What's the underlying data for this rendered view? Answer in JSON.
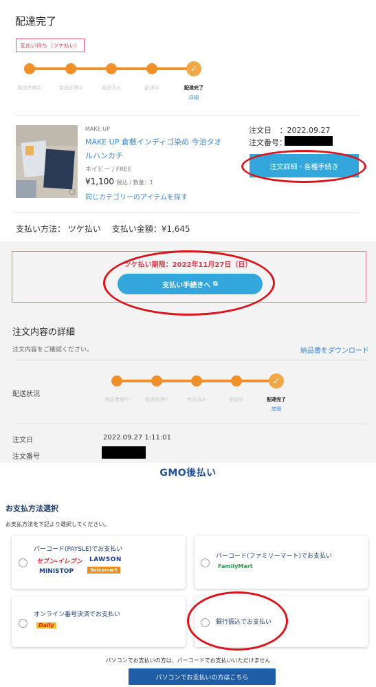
{
  "status": {
    "title": "配達完了",
    "wait_badge": "支払い待ち（ツケ払い）",
    "steps": [
      "発送準備中",
      "発送処理中",
      "発送済み",
      "配送中",
      "配達完了"
    ],
    "detail_link": "詳細"
  },
  "product": {
    "category": "MAKE UP",
    "name": "MAKE UP 倉敷インディゴ染め 今治タオルハンカチ",
    "variant": "ネイビー / FREE",
    "price": "¥1,100",
    "tax_qty": "税込 / 数量：1",
    "same_category_link": "同じカテゴリーのアイテムを探す"
  },
  "order": {
    "date_label": "注文日",
    "date_value": "：2022.09.27",
    "number_label": "注文番号",
    "number_colon": "：",
    "detail_button": "注文詳細・各種手続き"
  },
  "payment_summary": {
    "method_label": "支払い方法：",
    "method_value": "ツケ払い",
    "amount_label": "支払い金額：",
    "amount_value": "¥1,645"
  },
  "deadline": {
    "text": "ツケ払い期限：2022年11月27日（日）",
    "pay_button": "支払い手続きへ"
  },
  "details": {
    "heading": "注文内容の詳細",
    "sub": "注文内容をご確認ください。",
    "invoice_link": "納品書をダウンロード",
    "shipping_label": "配送状況",
    "order_date_label": "注文日",
    "order_date_value": "2022.09.27 1:11:01",
    "order_number_label": "注文番号"
  },
  "gmo": {
    "logo_gmo": "GMO",
    "logo_rest": "後払い",
    "heading": "お支払方法選択",
    "sub": "お支払方法を下記より選択してください。",
    "options": [
      {
        "title": "バーコード(PAYSLE)でお支払い"
      },
      {
        "title": "バーコード(ファミリーマート)でお支払い"
      },
      {
        "title": "オンライン番号決済でお支払い"
      },
      {
        "title": "銀行振込でお支払い"
      }
    ],
    "store_logos": {
      "seven": "セブン-イレブン",
      "lawson": "LAWSON",
      "ministop": "MINISTOP",
      "seicomart": "Seicomart",
      "familymart": "FamilyMart",
      "daily": "Daily"
    },
    "pc_note": "パソコンでお支払いの方は、バーコードでお支払いいただけません",
    "pc_button": "パソコンでお支払いの方はこちら"
  },
  "colors": {
    "accent_blue": "#33a7dc",
    "progress_orange": "#f0902a",
    "annotation_red": "#d9151b",
    "gmo_navy": "#1f5ea7"
  }
}
